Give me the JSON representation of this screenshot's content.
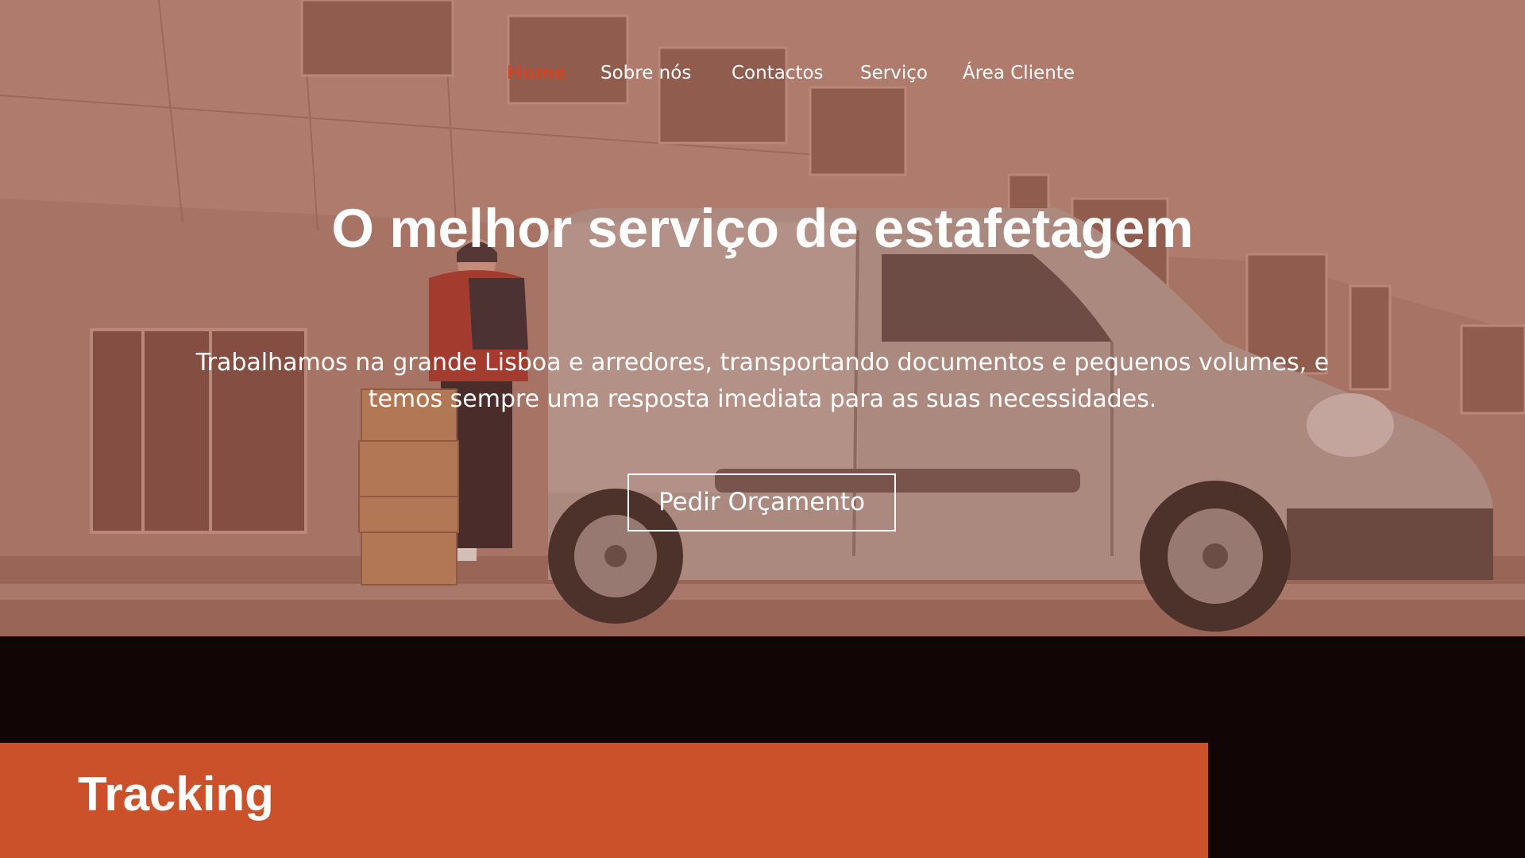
{
  "nav": {
    "items": [
      {
        "label": "Home",
        "active": true
      },
      {
        "label": "Sobre nós",
        "active": false
      },
      {
        "label": "Contactos",
        "active": false
      },
      {
        "label": "Serviço",
        "active": false
      },
      {
        "label": "Área Cliente",
        "active": false
      }
    ]
  },
  "hero": {
    "title": "O melhor serviço de estafetagem",
    "subtitle_line1": "Trabalhamos na grande Lisboa e arredores, transportando documentos e pequenos volumes, e",
    "subtitle_line2": "temos sempre uma resposta imediata para as suas necessidades.",
    "cta_label": "Pedir Orçamento"
  },
  "tracking": {
    "title": "Tracking"
  },
  "colors": {
    "accent": "#cb512b",
    "nav_active": "#c9482a",
    "dark_background": "#120505",
    "hero_tint": "#a97e72"
  },
  "hero_image": {
    "depicts": "courier-with-boxes-and-delivery-van"
  }
}
